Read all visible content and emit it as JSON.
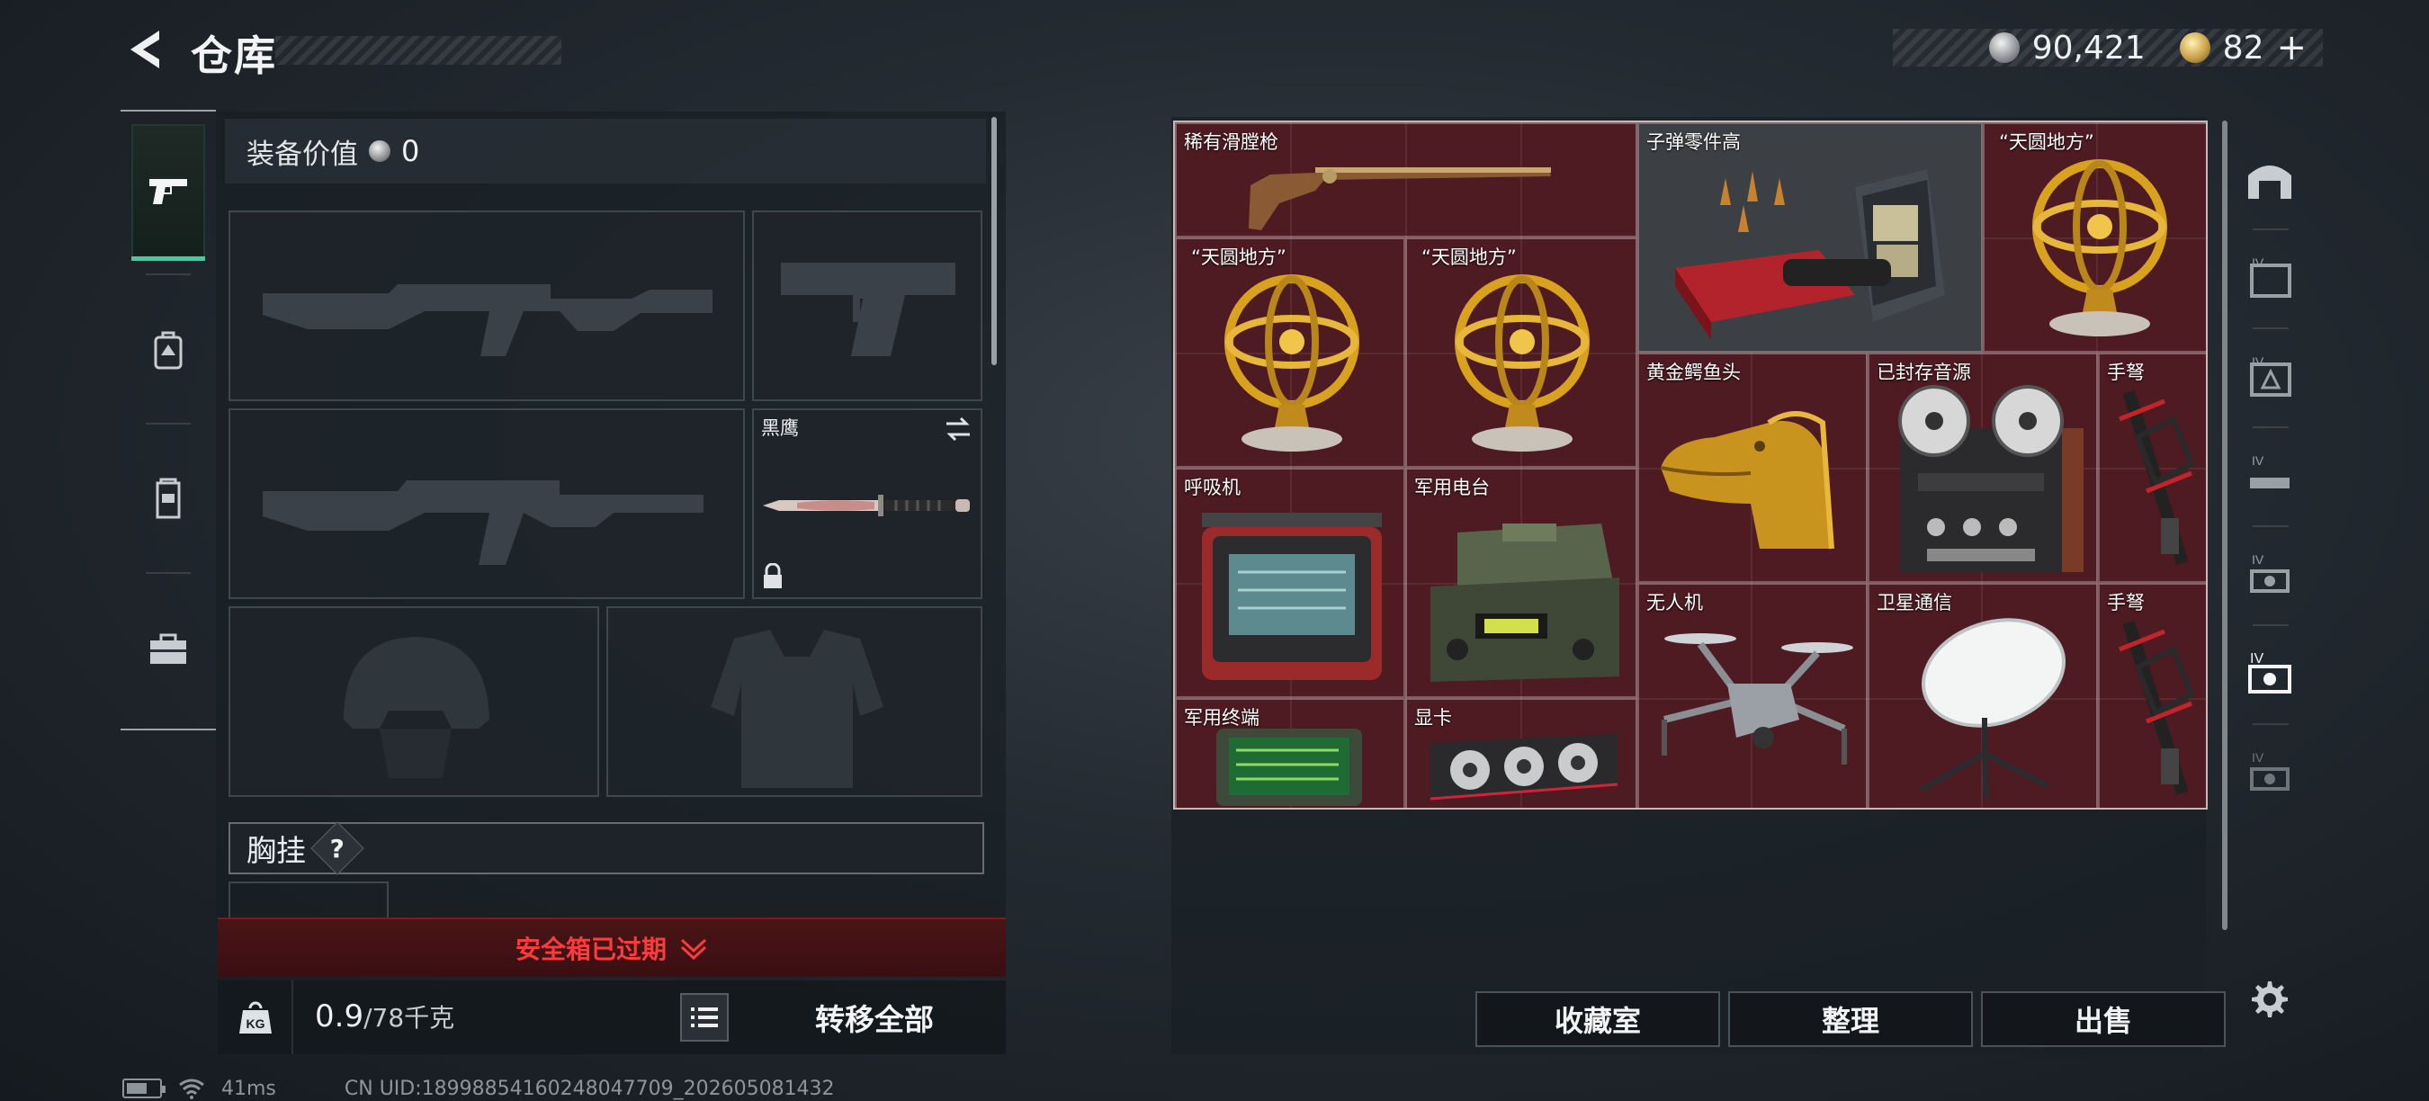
{
  "header": {
    "title": "仓库"
  },
  "currency": {
    "silver": "90,421",
    "gold": "82",
    "gold_add": "+"
  },
  "sidebar": {
    "categories": [
      {
        "icon": "pistol-icon",
        "active": true
      },
      {
        "icon": "backpack-icon",
        "active": false
      },
      {
        "icon": "vest-icon",
        "active": false
      },
      {
        "icon": "toolbox-icon",
        "active": false
      }
    ]
  },
  "equipment": {
    "value_label": "装备价值",
    "value": "0",
    "melee_name": "黑鹰",
    "chest_label": "胸挂",
    "help": "?"
  },
  "safebox": {
    "status": "安全箱已过期"
  },
  "transfer": {
    "weight_current": "0.9",
    "weight_max": "/78千克",
    "transfer_all": "转移全部"
  },
  "status_bar": {
    "ping": "41ms",
    "uid": "CN UID:18998854160248047709_202605081432"
  },
  "stash": {
    "items": [
      {
        "name": "稀有滑膛枪"
      },
      {
        "name": "子弹零件高"
      },
      {
        "name": "“天圆地方”"
      },
      {
        "name": "“天圆地方”"
      },
      {
        "name": "“天圆地方”"
      },
      {
        "name": "黄金鳄鱼头"
      },
      {
        "name": "已封存音源"
      },
      {
        "name": "手弩"
      },
      {
        "name": "呼吸机"
      },
      {
        "name": "军用电台"
      },
      {
        "name": "无人机"
      },
      {
        "name": "卫星通信"
      },
      {
        "name": "手弩"
      },
      {
        "name": "军用终端"
      },
      {
        "name": "显卡"
      }
    ]
  },
  "actions": {
    "collection": "收藏室",
    "organize": "整理",
    "sell": "出售"
  },
  "colors": {
    "accent": "#3fcf9d",
    "warning": "#ff3c3c",
    "stash_bg": "#4d1b21",
    "item_grey": "#3c3f44"
  }
}
